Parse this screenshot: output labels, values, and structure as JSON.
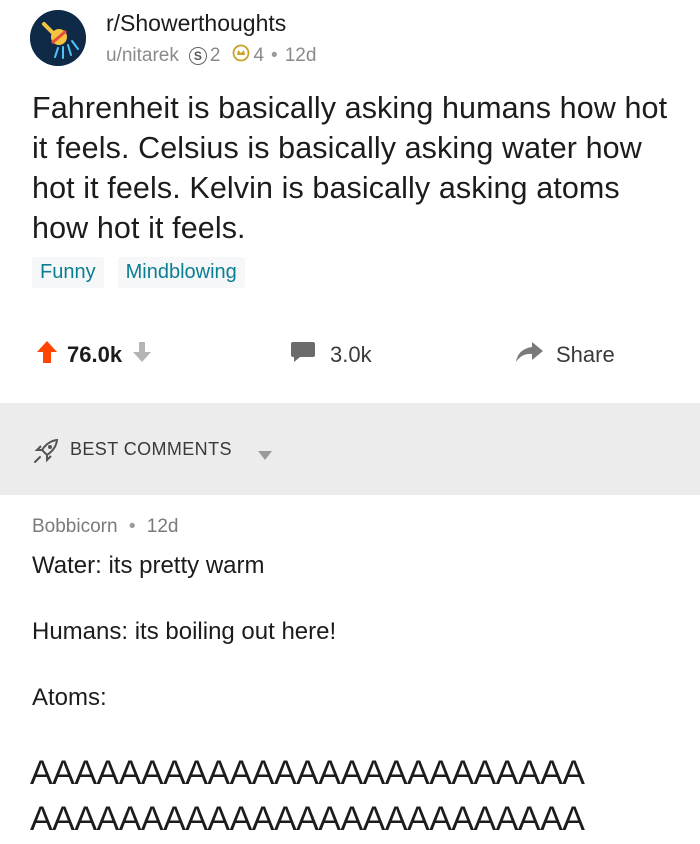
{
  "post": {
    "subreddit": "r/Showerthoughts",
    "author": "u/nitarek",
    "silver_count": "2",
    "gold_count": "4",
    "age": "12d",
    "title": "Fahrenheit is basically asking humans how hot it feels. Celsius is basically asking water how hot it feels. Kelvin is basically asking atoms how hot it feels.",
    "flairs": [
      "Funny",
      "Mindblowing"
    ]
  },
  "actions": {
    "upvotes": "76.0k",
    "comments": "3.0k",
    "share_label": "Share"
  },
  "sort": {
    "label": "BEST COMMENTS"
  },
  "comment": {
    "author": "Bobbicorn",
    "age": "12d",
    "lines": [
      "Water: its pretty warm",
      "Humans: its boiling out here!",
      "Atoms:",
      "AAAAAAAAAAAAAAAAAAAAAAAAA",
      "AAAAAAAAAAAAAAAAAAAAAAAAA"
    ]
  },
  "colors": {
    "upvote_orange": "#ff4500",
    "flair_teal": "#0b7e92",
    "avatar_navy": "#0e2a47"
  }
}
